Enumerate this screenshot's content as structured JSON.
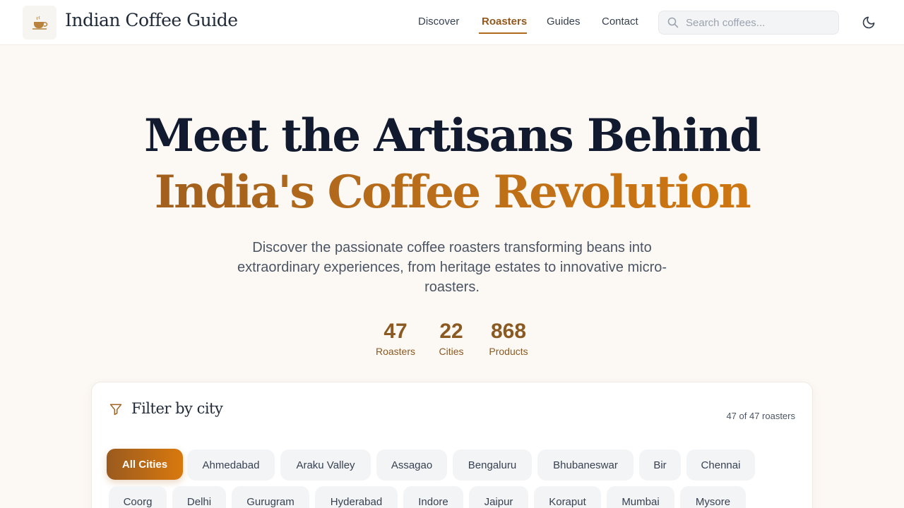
{
  "header": {
    "site_title": "Indian Coffee Guide",
    "nav": [
      {
        "label": "Discover",
        "active": false
      },
      {
        "label": "Roasters",
        "active": true
      },
      {
        "label": "Guides",
        "active": false
      },
      {
        "label": "Contact",
        "active": false
      }
    ],
    "search_placeholder": "Search coffees...",
    "icons": {
      "logo": "coffee-cup-icon",
      "search": "search-icon",
      "theme": "moon-icon"
    }
  },
  "hero": {
    "title_line1": "Meet the Artisans Behind",
    "title_line2": "India's Coffee Revolution",
    "description": "Discover the passionate coffee roasters transforming beans into extraordinary experiences, from heritage estates to innovative micro-roasters."
  },
  "stats": [
    {
      "value": "47",
      "label": "Roasters"
    },
    {
      "value": "22",
      "label": "Cities"
    },
    {
      "value": "868",
      "label": "Products"
    }
  ],
  "filter": {
    "title": "Filter by city",
    "count_text": "47 of 47 roasters",
    "selected": "All Cities",
    "cities": [
      "All Cities",
      "Ahmedabad",
      "Araku Valley",
      "Assagao",
      "Bengaluru",
      "Bhubaneswar",
      "Bir",
      "Chennai",
      "Coorg",
      "Delhi",
      "Gurugram",
      "Hyderabad",
      "Indore",
      "Jaipur",
      "Koraput",
      "Mumbai",
      "Mysore"
    ]
  },
  "colors": {
    "accent": "#b06a1c",
    "accent_dark": "#8a5a22",
    "gradient_start": "#93571e",
    "gradient_end": "#d97b0c"
  }
}
